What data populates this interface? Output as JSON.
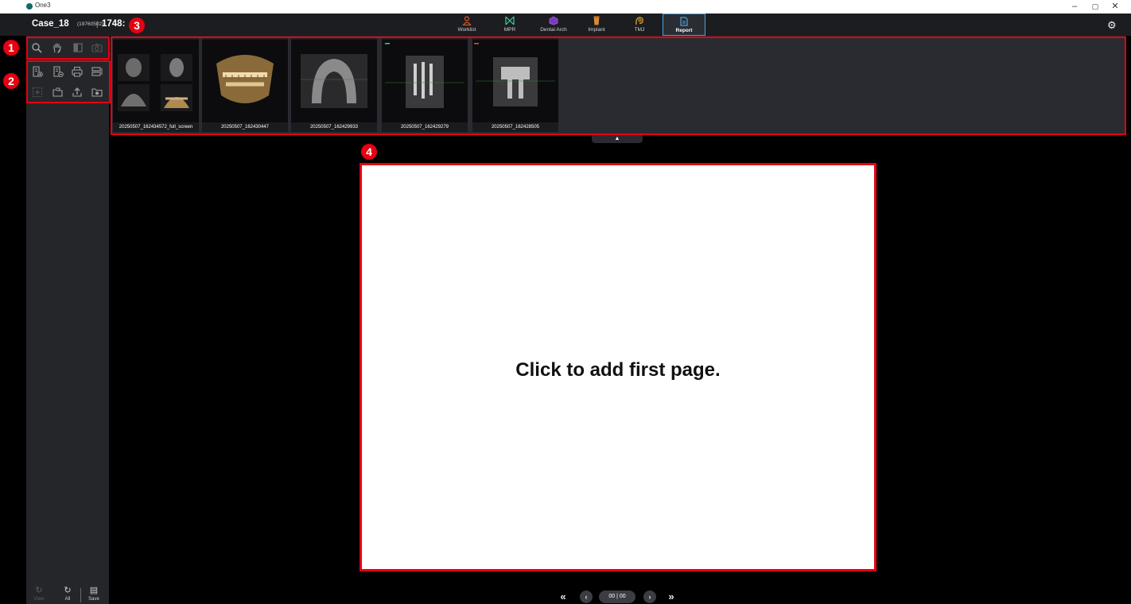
{
  "window": {
    "app_name": "One3",
    "minimize": "–",
    "maximize": "▢",
    "close": "✕"
  },
  "header": {
    "case_name": "Case_18",
    "case_id": "(19760502)",
    "separator": "|",
    "case_number": "1748:",
    "tabs": [
      {
        "label": "Worklist",
        "icon": "person-icon",
        "color": "#e0552a"
      },
      {
        "label": "MPR",
        "icon": "mpr-icon",
        "color": "#3ecf9a"
      },
      {
        "label": "Dental Arch",
        "icon": "dental-arch-icon",
        "color": "#a050e0"
      },
      {
        "label": "Implant",
        "icon": "implant-icon",
        "color": "#e08a2a"
      },
      {
        "label": "TMJ",
        "icon": "tmj-icon",
        "color": "#e0a020"
      },
      {
        "label": "Report",
        "icon": "report-icon",
        "color": "#4aa3df",
        "active": true
      }
    ]
  },
  "toolbar": {
    "view_tools": [
      "zoom-icon",
      "pan-hand-icon",
      "window-level-icon",
      "camera-icon"
    ],
    "report_tools": [
      "add-page-icon",
      "remove-page-icon",
      "print-icon",
      "layout-icon",
      "fit-icon",
      "open-folder-icon",
      "export-icon",
      "capture-folder-icon"
    ]
  },
  "bottom_tools": [
    {
      "label": "View",
      "icon": "refresh-icon",
      "enabled": false
    },
    {
      "label": "All",
      "icon": "refresh-all-icon",
      "enabled": true
    },
    {
      "label": "Save",
      "icon": "save-icon",
      "enabled": true
    }
  ],
  "thumbnails": [
    {
      "caption": "20250507_162434572_full_screen"
    },
    {
      "caption": "20250507_162430447"
    },
    {
      "caption": "20250507_162429933"
    },
    {
      "caption": "20250507_162429279"
    },
    {
      "caption": "20250507_162428505"
    }
  ],
  "strip_toggle": "▲",
  "markers": [
    "1",
    "2",
    "3",
    "4"
  ],
  "page": {
    "placeholder": "Click to add first page."
  },
  "pager": {
    "first": "«",
    "prev": "‹",
    "count": "00 | 00",
    "next": "›",
    "last": "»"
  },
  "colors": {
    "annotation": "#e60012",
    "active_tab_border": "#4aa3df"
  }
}
